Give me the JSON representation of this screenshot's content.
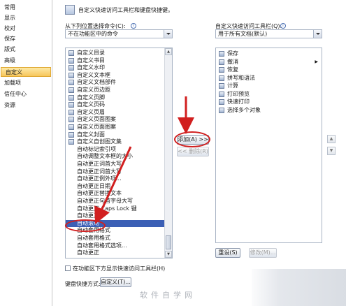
{
  "nav": {
    "items": [
      {
        "label": "常用"
      },
      {
        "label": "显示"
      },
      {
        "label": "校对"
      },
      {
        "label": "保存"
      },
      {
        "label": "版式"
      },
      {
        "label": "高级"
      },
      {
        "label": "自定义"
      },
      {
        "label": "加载项"
      },
      {
        "label": "信任中心"
      },
      {
        "label": "资源"
      }
    ],
    "selected_index": 6
  },
  "header": {
    "text": "自定义快速访问工具栏和键盘快捷键。"
  },
  "left": {
    "label": "从下列位置选择命令(C):",
    "combo_value": "不在功能区中的命令",
    "items": [
      {
        "label": "自定义目录",
        "icon": "doc-icon"
      },
      {
        "label": "自定义书目",
        "icon": "doc-icon"
      },
      {
        "label": "自定义水印",
        "icon": "doc-icon"
      },
      {
        "label": "自定义文本框",
        "icon": "doc-icon"
      },
      {
        "label": "自定义文档部件",
        "icon": "doc-icon"
      },
      {
        "label": "自定义页边距",
        "icon": "doc-icon"
      },
      {
        "label": "自定义页脚",
        "icon": "doc-icon"
      },
      {
        "label": "自定义页码",
        "icon": "doc-icon"
      },
      {
        "label": "自定义页眉",
        "icon": "doc-icon"
      },
      {
        "label": "自定义页面图案",
        "icon": "doc-icon"
      },
      {
        "label": "自定义页面图案",
        "icon": "doc-icon"
      },
      {
        "label": "自定义封面",
        "icon": "doc-icon"
      },
      {
        "label": "自定义自创图文集",
        "icon": "doc-icon"
      },
      {
        "label": "自动标记索引项",
        "icon": ""
      },
      {
        "label": "自动调整文本框的大小",
        "icon": ""
      },
      {
        "label": "自动更正词首大写",
        "icon": ""
      },
      {
        "label": "自动更正词首大写",
        "icon": ""
      },
      {
        "label": "自动更正例外项...",
        "icon": ""
      },
      {
        "label": "自动更正日期",
        "icon": ""
      },
      {
        "label": "自动更正替换文本",
        "icon": ""
      },
      {
        "label": "自动更正句首字母大写",
        "icon": ""
      },
      {
        "label": "自动更正 Caps Lock 键",
        "icon": ""
      },
      {
        "label": "自动更正",
        "icon": ""
      },
      {
        "label": "自动滚动",
        "icon": ""
      },
      {
        "label": "自动套用格式",
        "icon": ""
      },
      {
        "label": "自动套用格式",
        "icon": ""
      },
      {
        "label": "自动套用格式选项...",
        "icon": ""
      },
      {
        "label": "自动更正",
        "icon": ""
      }
    ],
    "selected_index": 23
  },
  "right": {
    "label": "自定义快速访问工具栏(Q):",
    "combo_value": "用于所有文档(默认)",
    "items": [
      {
        "label": "保存",
        "icon": "save-icon"
      },
      {
        "label": "撤消",
        "icon": "undo-icon"
      },
      {
        "label": "恢复",
        "icon": "redo-icon"
      },
      {
        "label": "拼写和语法",
        "icon": "spelling-icon"
      },
      {
        "label": "计算",
        "icon": "calculate-icon"
      },
      {
        "label": "打印预览",
        "icon": "print-preview-icon"
      },
      {
        "label": "快速打印",
        "icon": "quick-print-icon"
      },
      {
        "label": "选择多个对象",
        "icon": "select-objects-icon"
      }
    ]
  },
  "buttons": {
    "add": "添加(A) >>",
    "remove": "<< 删除(R)",
    "reset": "重设(S)",
    "modify": "修改(M)..."
  },
  "below_ribbon_checkbox": "在功能区下方显示快速访问工具栏(H)",
  "keyboard": {
    "label": "键盘快捷方式:",
    "button": "自定义(T)..."
  },
  "watermark": "软件自学网",
  "colors": {
    "selection": "#3b5fb5",
    "annotation": "#d11f1f",
    "nav_selected": "#f7c65b"
  }
}
